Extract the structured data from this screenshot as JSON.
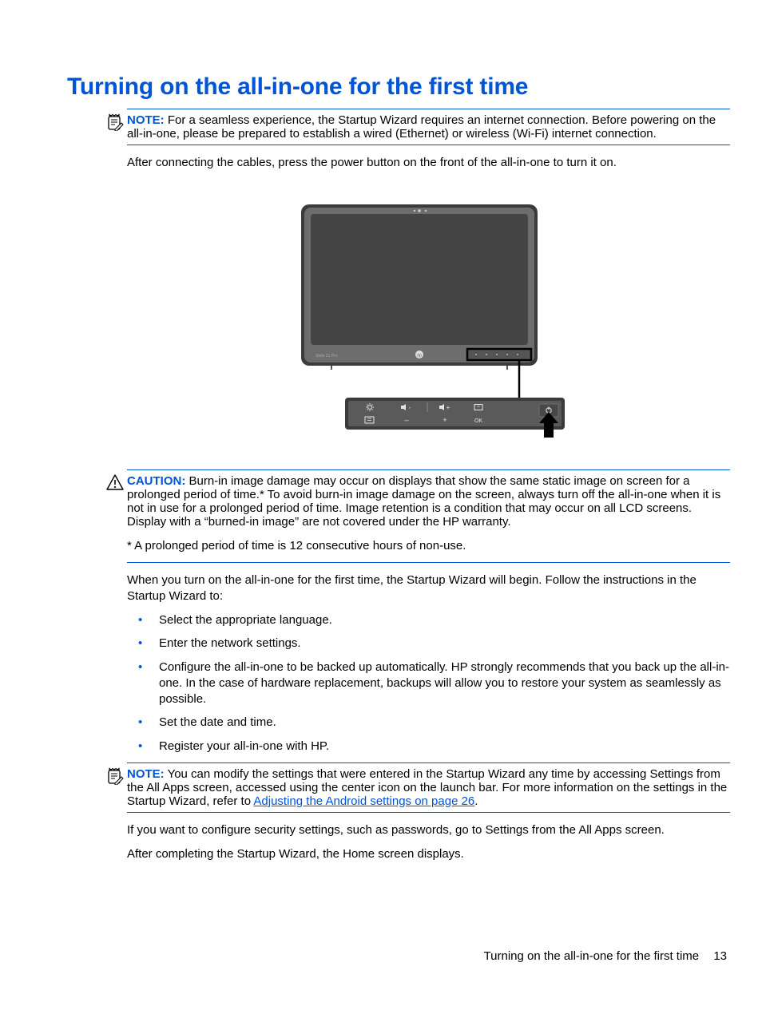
{
  "title": "Turning on the all-in-one for the first time",
  "note1": {
    "label": "NOTE:",
    "text": "For a seamless experience, the Startup Wizard requires an internet connection. Before powering on the all-in-one, please be prepared to establish a wired (Ethernet) or wireless (Wi-Fi) internet connection."
  },
  "p_after_cables": "After connecting the cables, press the power button on the front of the all-in-one to turn it on.",
  "caution": {
    "label": "CAUTION:",
    "text": "Burn-in image damage may occur on displays that show the same static image on screen for a prolonged period of time.* To avoid burn-in image damage on the screen, always turn off the all-in-one when it is not in use for a prolonged period of time. Image retention is a condition that may occur on all LCD screens. Display with a “burned-in image” are not covered under the HP warranty.",
    "footnote": "* A prolonged period of time is 12 consecutive hours of non-use."
  },
  "p_wizard_intro": "When you turn on the all-in-one for the first time, the Startup Wizard will begin. Follow the instructions in the Startup Wizard to:",
  "bullets": [
    "Select the appropriate language.",
    "Enter the network settings.",
    "Configure the all-in-one to be backed up automatically. HP strongly recommends that you back up the all-in-one. In the case of hardware replacement, backups will allow you to restore your system as seamlessly as possible.",
    "Set the date and time.",
    "Register your all-in-one with HP."
  ],
  "note2": {
    "label": "NOTE:",
    "pre": "You can modify the settings that were entered in the Startup Wizard any time by accessing Settings from the All Apps screen, accessed using the center icon on the launch bar. For more information on the settings in the Startup Wizard, refer to ",
    "link": "Adjusting the Android settings on page 26",
    "post": "."
  },
  "p_security": "If you want to configure security settings, such as passwords, go to Settings from the All Apps screen.",
  "p_home": "After completing the Startup Wizard, the Home screen displays.",
  "footer": {
    "text": "Turning on the all-in-one for the first time",
    "page": "13"
  }
}
